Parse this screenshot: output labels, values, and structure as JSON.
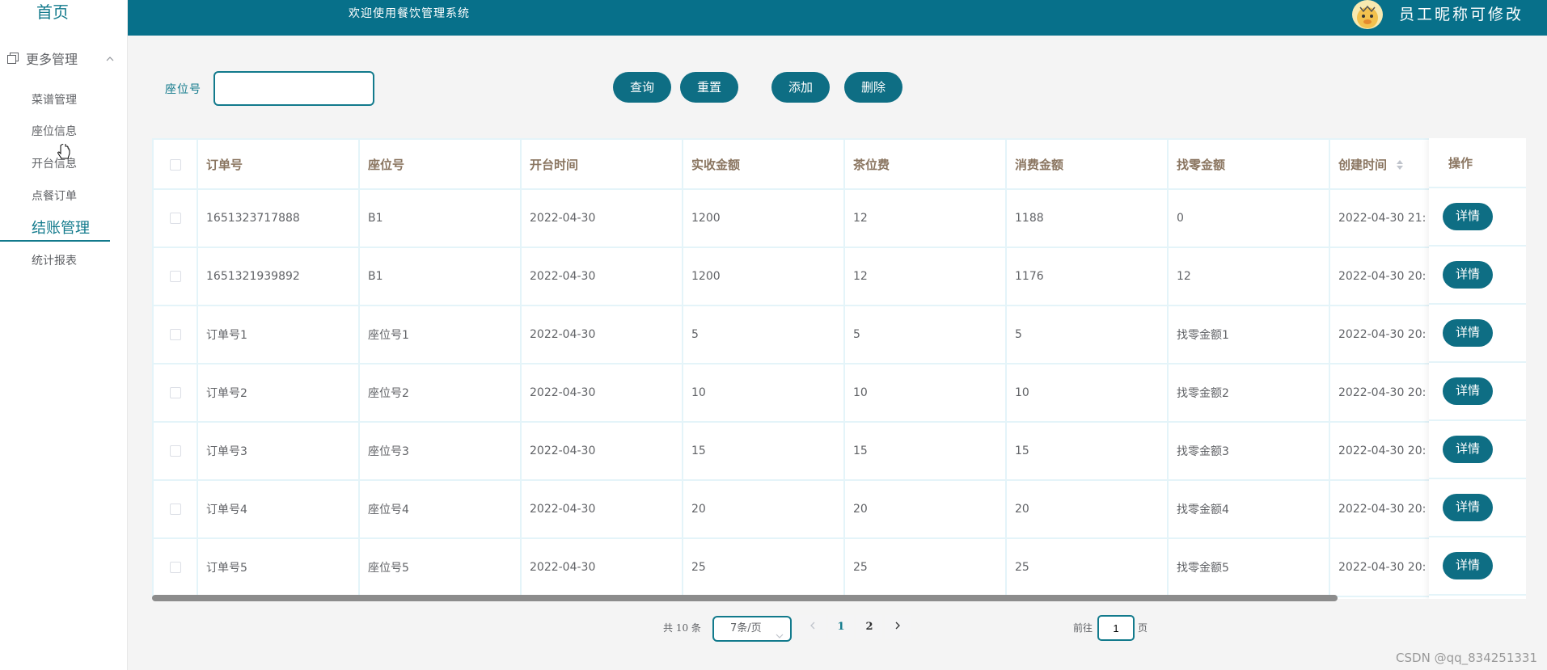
{
  "sidebar": {
    "home": "首页",
    "group_label": "更多管理",
    "items": [
      {
        "label": "菜谱管理"
      },
      {
        "label": "座位信息"
      },
      {
        "label": "开台信息"
      },
      {
        "label": "点餐订单"
      },
      {
        "label": "结账管理"
      },
      {
        "label": "统计报表"
      }
    ]
  },
  "header": {
    "welcome": "欢迎使用餐饮管理系统",
    "user_nick": "员工昵称可修改"
  },
  "search": {
    "label": "座位号",
    "value": "",
    "query_label": "查询",
    "reset_label": "重置",
    "add_label": "添加",
    "delete_label": "删除"
  },
  "table": {
    "columns": [
      "订单号",
      "座位号",
      "开台时间",
      "实收金额",
      "茶位费",
      "消费金额",
      "找零金额",
      "创建时间"
    ],
    "op_header": "操作",
    "detail_label": "详情",
    "rows": [
      {
        "order": "1651323717888",
        "seat": "B1",
        "open": "2022-04-30",
        "received": "1200",
        "tea": "12",
        "spend": "1188",
        "change": "0",
        "created": "2022-04-30 21:"
      },
      {
        "order": "1651321939892",
        "seat": "B1",
        "open": "2022-04-30",
        "received": "1200",
        "tea": "12",
        "spend": "1176",
        "change": "12",
        "created": "2022-04-30 20:"
      },
      {
        "order": "订单号1",
        "seat": "座位号1",
        "open": "2022-04-30",
        "received": "5",
        "tea": "5",
        "spend": "5",
        "change": "找零金额1",
        "created": "2022-04-30 20:"
      },
      {
        "order": "订单号2",
        "seat": "座位号2",
        "open": "2022-04-30",
        "received": "10",
        "tea": "10",
        "spend": "10",
        "change": "找零金额2",
        "created": "2022-04-30 20:"
      },
      {
        "order": "订单号3",
        "seat": "座位号3",
        "open": "2022-04-30",
        "received": "15",
        "tea": "15",
        "spend": "15",
        "change": "找零金额3",
        "created": "2022-04-30 20:"
      },
      {
        "order": "订单号4",
        "seat": "座位号4",
        "open": "2022-04-30",
        "received": "20",
        "tea": "20",
        "spend": "20",
        "change": "找零金额4",
        "created": "2022-04-30 20:"
      },
      {
        "order": "订单号5",
        "seat": "座位号5",
        "open": "2022-04-30",
        "received": "25",
        "tea": "25",
        "spend": "25",
        "change": "找零金额5",
        "created": "2022-04-30 20:"
      }
    ]
  },
  "pagination": {
    "total": "共 10 条",
    "page_size": "7条/页",
    "prev_icon": "chevron-left",
    "pages": [
      "1",
      "2"
    ],
    "next_icon": "chevron-right",
    "goto_label": "前往",
    "goto_value": "1",
    "unit": "页"
  },
  "watermark": "CSDN @qq_834251331",
  "colors": {
    "primary": "#07708a",
    "button": "#0e6e84",
    "header_text": "#8a7560"
  }
}
